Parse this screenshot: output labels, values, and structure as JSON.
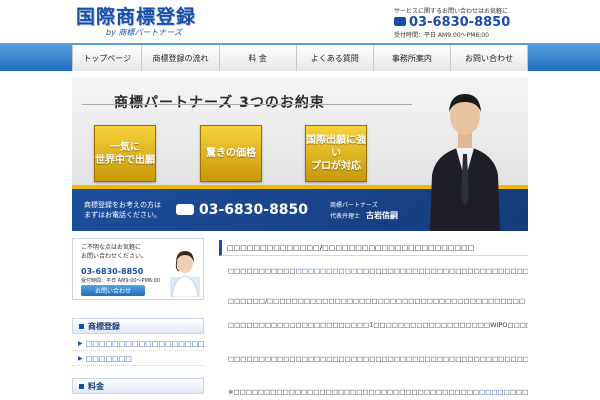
{
  "header": {
    "logo_main": "国際商標登録",
    "logo_sub": "by 商標パートナーズ",
    "contact_note": "サービスに関するお問い合わせはお気軽に",
    "phone": "03-6830-8850",
    "hours": "受付時間：平日 AM9:00～PM6:00"
  },
  "nav": {
    "items": [
      {
        "label": "トップページ"
      },
      {
        "label": "商標登録の流れ"
      },
      {
        "label": "料 金"
      },
      {
        "label": "よくある質問"
      },
      {
        "label": "事務所案内"
      },
      {
        "label": "お問い合わせ"
      }
    ]
  },
  "hero": {
    "title": "商標パートナーズ 3つのお約束",
    "promises": [
      {
        "line1": "一気に",
        "line2": "世界中で出願"
      },
      {
        "line1": "驚きの価格",
        "line2": ""
      },
      {
        "line1": "国際出願に強い",
        "line2": "プロが対応"
      }
    ],
    "call_line1": "商標登録をお考えの方は",
    "call_line2": "まずはお電話ください。",
    "phone": "03-6830-8850",
    "firm": "商標パートナーズ",
    "role": "代表弁理士",
    "name": "古岩信嗣"
  },
  "sidebar": {
    "contact_line1": "ご不明な点はお気軽に",
    "contact_line2": "お問い合わせください。",
    "phone": "03-6830-8850",
    "hours": "受付時間：平日 AM9:00～PM6:00",
    "button": "お問い合わせ",
    "section1_title": "商標登録",
    "section1_links": [
      {
        "label": "□□□□□□□□□□□□□□□□□□□□"
      },
      {
        "label": "□□□□□□□"
      }
    ],
    "section2_title": "料金"
  },
  "main": {
    "title": "□□□□□□□□□□□□□□/□□□□□□□□□□□□□□□□□□□□□□□",
    "paragraphs": [
      {
        "pre": "□□□□□□□□□□□",
        "hl": "□□□□□□□□□□□",
        "post": "□□□□□□□□□□□□□□□□□□□□□□□□□□□□□□□□□□□□□□□□□□□□□□□□□□□□□□□□□□□□□□□□□□□□□□□□□□□□□□□□□□□□□□□□□□□□□□□□□□"
      },
      {
        "pre": "□□□□□□/□□□□□□□□□□□□□□□□□□□□□□□□□□□□□□□□□□□□□□□□□□",
        "hl": "",
        "post": ""
      },
      {
        "pre": "□□□□□□□□□□□□□□□□□□□□□□□1□□□□□□□□□□□□□□□□□□□WIPO□□□□□□□□□□□□□□□□□□□□□□□□□□□□□□□□□□□□□□□□□□□□□□□□□□□□□□□□□□□□□□□□□□□□",
        "hl": "",
        "post": ""
      },
      {
        "pre": "□□□□□□□□□□□□□□□□□□□□□□□□□□□□□□□□□□□□□□□□□□□□□□□□□□□□□□□□□□□□□□□□□□□□□□□□□□□□□□□□□□□□□□□□□□",
        "hl": "",
        "post": ""
      },
      {
        "pre": "※□□□□□□□□□□□□□□□□□□□□□□□□□□□□□□□□□□□□□□□□",
        "hl": "□□□□□",
        "post": "□□□□□□□"
      }
    ]
  },
  "colors": {
    "brand_blue": "#1a4fa8",
    "gold": "#e0b010",
    "navy": "#143b7a"
  }
}
